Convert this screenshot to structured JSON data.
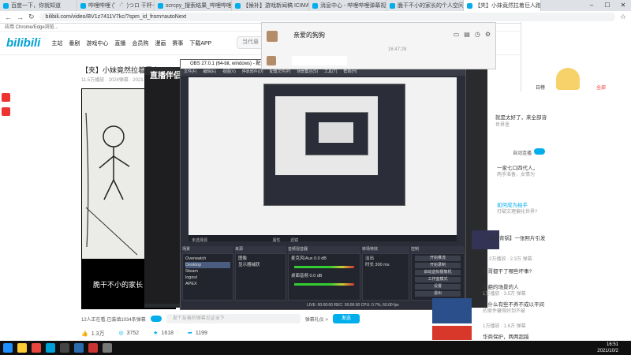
{
  "browser": {
    "tabs": [
      {
        "label": "百度一下，你就知道"
      },
      {
        "label": "哔哩哔哩 (゜-゜)つロ 干杯~-bi"
      },
      {
        "label": "scrcpy_搜索结果_哔哩哔哩_bili"
      },
      {
        "label": "【候补】游戏新闻稿 ICIMA 公"
      },
      {
        "label": "消息中心 - 哔哩哔哩弹幕视频网"
      },
      {
        "label": "脆干不小的家长的个人空间_哔"
      },
      {
        "label": "【夹】小妹竟然拉着巨人跑了"
      }
    ],
    "url": "bilibili.com/video/BV1z7411V7kc/?spm_id_from=autoNext",
    "bookmarks": "应用   Chrome/Edge浏览..."
  },
  "site": {
    "logo": "bilibili",
    "nav": [
      "主站",
      "番剧",
      "游戏中心",
      "直播",
      "会员购",
      "漫画",
      "赛事"
    ],
    "download": "下载APP",
    "search_placeholder": "当代悬"
  },
  "video": {
    "title": "【夹】小妹竟然拉着巨人",
    "meta": "11.5万播放 · 2024弹幕 · 2021-",
    "subtitle": "脆干不小的家长",
    "danmu_count": "12人正在看,已装填1034条弹幕",
    "danmu_placeholder": "发个友善的弹幕见证当下",
    "send_label": "发送",
    "etiquette": "弹幕礼仪 >",
    "actions": [
      {
        "icon": "like-icon",
        "count": "1.3万"
      },
      {
        "icon": "coin-icon",
        "count": "3752"
      },
      {
        "icon": "favorite-icon",
        "count": "1618"
      },
      {
        "icon": "share-icon",
        "count": "1199"
      }
    ]
  },
  "overlay": {
    "brand": "直播伴侣"
  },
  "obs": {
    "title": "OBS 27.0.1 (64-bit, windows) - 配置文件: 未命名 - 场景: 未命名",
    "menu": [
      "文件(F)",
      "编辑(E)",
      "视图(V)",
      "停靠部件(D)",
      "配置文件(P)",
      "场景集合(S)",
      "工具(T)",
      "帮助(H)"
    ],
    "scenes_header": "场景",
    "sources_header": "来源",
    "mixer_header": "音频混音器",
    "transition_header": "转场特效",
    "controls_header": "控制",
    "scenes": [
      "Overwatch",
      "Desktop",
      "Steam",
      "logout",
      "APEX"
    ],
    "sources": [
      "图像",
      "显示器捕获"
    ],
    "mixer": [
      {
        "name": "麦克风/Aux",
        "db": "0.0 dB"
      },
      {
        "name": "桌面音频",
        "db": "0.0 dB"
      }
    ],
    "transition": {
      "type": "淡出",
      "duration_label": "时长",
      "duration": "300 ms"
    },
    "controls": [
      "开始推流",
      "开始录制",
      "启动虚拟摄像机",
      "工作室模式",
      "设置",
      "退出"
    ],
    "status": "LIVE: 00:00:00   REC: 00:00:00   CPU: 0.7%, 60.00 fps",
    "no_source": "未选择源",
    "props": "属性",
    "filters": "滤镜"
  },
  "chat": {
    "name": "亲爱的狗狗",
    "time": "16:47:28",
    "icons": [
      "window-icon",
      "folder-icon",
      "history-icon",
      "settings-icon"
    ]
  },
  "right": {
    "items": [
      {
        "title": "就是太好了，来全部溶",
        "meta": "世界里"
      },
      {
        "title": "一家七口四代人，",
        "meta": "两手准备，女情为"
      },
      {
        "title": "如何成为拍手",
        "meta": "打破文理偏化世界?"
      },
      {
        "title": "实力背锅】一张照片引发",
        "meta": "2万播放 · 2.3万 弹幕"
      },
      {
        "title": "给哥都干了哪些坏事?",
        "meta": ""
      },
      {
        "title": "奇葩的场景的人",
        "meta": "1万播放 · 3.5万 弹幕"
      },
      {
        "title": "为什么有些不养不成以平间",
        "meta": "的案件藏得好到不被"
      },
      {
        "title": "华商保护，两两超越",
        "meta": "1万播放 · 1.6万 弹幕"
      }
    ],
    "autoplay_label": "自动连播",
    "stream_tabs": [
      "日榜",
      "直播",
      "全部"
    ]
  },
  "taskbar": {
    "time": "16:51",
    "date": "2021/10/2"
  }
}
